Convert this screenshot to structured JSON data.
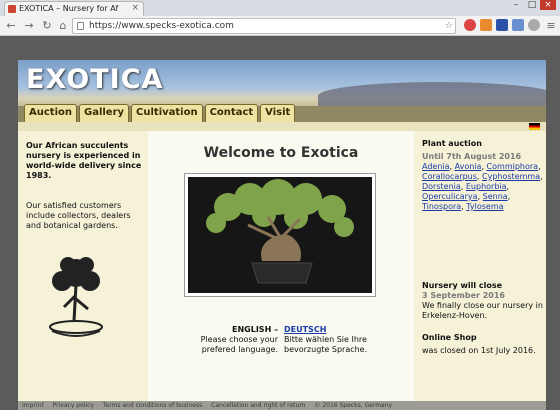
{
  "browser": {
    "tab_title": "EXOTICA – Nursery for Af",
    "tab_close": "×",
    "url": "https://www.specks-exotica.com",
    "window_buttons": [
      "–",
      "□",
      "×"
    ]
  },
  "site": {
    "logo": "EXOTICA",
    "nav": [
      "Auction",
      "Gallery",
      "Cultivation",
      "Contact",
      "Visit"
    ],
    "flag": "german-flag-icon"
  },
  "left": {
    "intro": "Our African succulents nursery is experienced in world-wide delivery since 1983.",
    "customers": "Our satisfied customers include collectors, dealers and botanical gardens."
  },
  "main": {
    "heading": "Welcome to Exotica",
    "lang_en": "ENGLISH",
    "lang_sep": "–",
    "lang_de": "DEUTSCH",
    "prompt_en": "Please choose your prefered language.",
    "prompt_de": "Bitte wählen Sie Ihre bevorzugte Sprache."
  },
  "right": {
    "auction_title": "Plant auction",
    "auction_date": "Until 7th August 2016",
    "auction_links": [
      "Adenia",
      "Avonia",
      "Commiphora",
      "Corallocarpus",
      "Cyphostemma",
      "Dorstenia",
      "Euphorbia",
      "Operculicarya",
      "Senna",
      "Tinospora",
      "Tylosema"
    ],
    "nursery_title": "Nursery will close",
    "nursery_date": "3 September 2016",
    "nursery_text": "We finally close our nursery in Erkelenz-Hoven.",
    "shop_title": "Online Shop",
    "shop_text": "was closed on 1st July 2016."
  },
  "footer": [
    "Imprint",
    "Privacy policy",
    "Terms and conditions of business",
    "Cancellation and right of return",
    "© 2016 Specks, Germany"
  ]
}
